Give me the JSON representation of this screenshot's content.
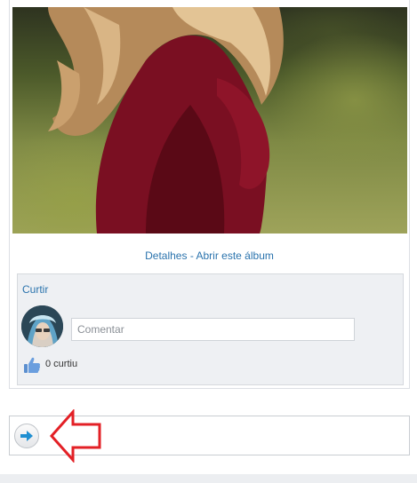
{
  "post": {
    "details_link": "Detalhes",
    "separator": " - ",
    "album_link": "Abrir este álbum"
  },
  "feedback": {
    "like_label": "Curtir",
    "comment_placeholder": "Comentar",
    "likes_count_text": "0 curtiu"
  },
  "icons": {
    "like": "thumbs-up-icon",
    "next": "arrow-right-icon",
    "annotation": "red-left-arrow"
  },
  "colors": {
    "link": "#2a73ad",
    "annotation_arrow": "#e32026",
    "panel_bg": "#eef0f3"
  }
}
